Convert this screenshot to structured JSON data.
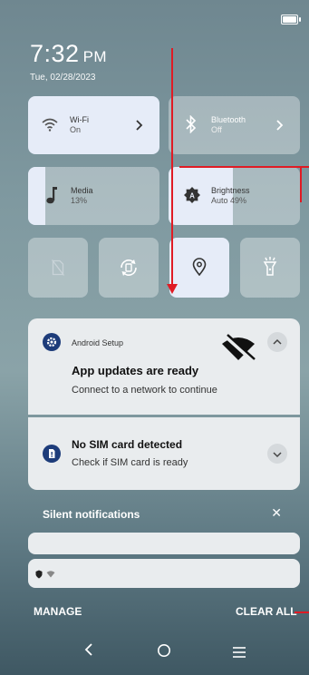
{
  "clock": {
    "time": "7:32",
    "ampm": "PM",
    "date": "Tue, 02/28/2023"
  },
  "tiles": {
    "wifi": {
      "title": "Wi-Fi",
      "status": "On"
    },
    "bluetooth": {
      "title": "Bluetooth",
      "status": "Off"
    },
    "media": {
      "title": "Media",
      "value": "13%",
      "level": 0.13
    },
    "brightness": {
      "title": "Brightness",
      "value": "Auto 49%",
      "level": 0.49
    }
  },
  "notifications": [
    {
      "app": "Android Setup",
      "title": "App updates are ready",
      "text": "Connect to a network to continue"
    },
    {
      "title": "No SIM card detected",
      "text": "Check if SIM card is ready"
    }
  ],
  "silent": {
    "label": "Silent notifications"
  },
  "footer": {
    "manage": "MANAGE",
    "clear_all": "CLEAR ALL"
  },
  "colors": {
    "accent": "#1d3c7a",
    "tile_active": "#e6ecf8",
    "annotation": "#e01b24"
  }
}
